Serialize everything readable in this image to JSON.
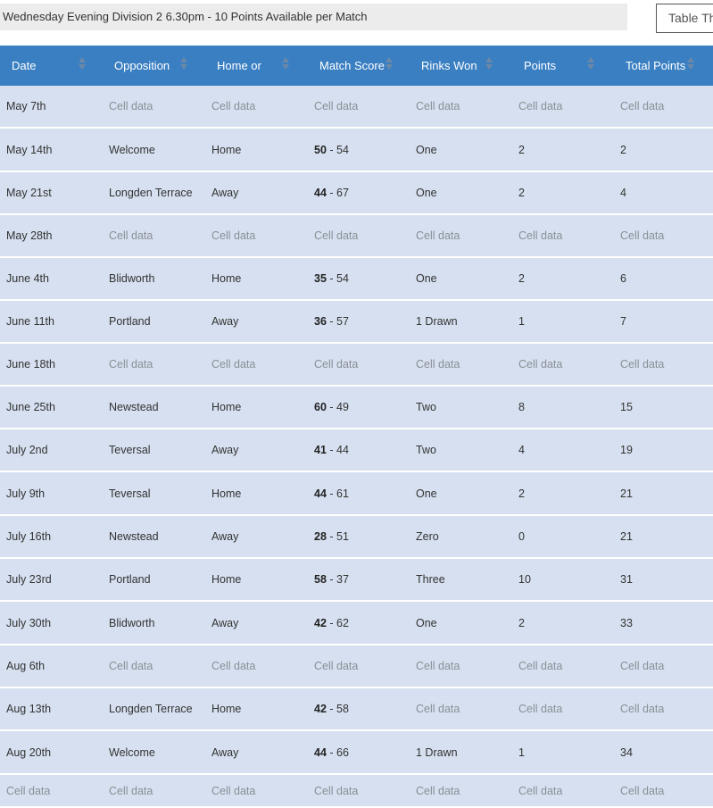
{
  "header": {
    "title": "Wednesday Evening Division 2 6.30pm - 10 Points Available per Match",
    "table_button": "Table Th"
  },
  "columns": [
    "Date",
    "Opposition",
    "Home or",
    "Match Score",
    "Rinks Won",
    "Points",
    "Total Points"
  ],
  "rows": [
    {
      "date": "May 7th",
      "opposition": "Cell data",
      "home_away": "Cell data",
      "score": "Cell data",
      "rinks": "Cell data",
      "points": "Cell data",
      "total": "Cell data"
    },
    {
      "date": "May 14th",
      "opposition": "Welcome",
      "home_away": "Home",
      "score_home": "50",
      "score_away": "- 54",
      "rinks": "One",
      "points": "2",
      "total": "2"
    },
    {
      "date": "May 21st",
      "opposition": "Longden Terrace",
      "home_away": "Away",
      "score_home": "44",
      "score_away": "- 67",
      "rinks": "One",
      "points": "2",
      "total": "4"
    },
    {
      "date": "May 28th",
      "opposition": "Cell data",
      "home_away": "Cell data",
      "score": "Cell data",
      "rinks": "Cell data",
      "points": "Cell data",
      "total": "Cell data"
    },
    {
      "date": "June 4th",
      "opposition": "Blidworth",
      "home_away": "Home",
      "score_home": "35",
      "score_away": "- 54",
      "rinks": "One",
      "points": "2",
      "total": "6"
    },
    {
      "date": "June 11th",
      "opposition": "Portland",
      "home_away": "Away",
      "score_home": "36",
      "score_away": "- 57",
      "rinks": "1 Drawn",
      "points": "1",
      "total": "7"
    },
    {
      "date": "June 18th",
      "opposition": "Cell data",
      "home_away": "Cell data",
      "score": "Cell data",
      "rinks": "Cell data",
      "points": "Cell data",
      "total": "Cell data"
    },
    {
      "date": "June 25th",
      "opposition": "Newstead",
      "home_away": "Home",
      "score_home": "60",
      "score_away": "- 49",
      "rinks": "Two",
      "points": "8",
      "total": "15"
    },
    {
      "date": "July 2nd",
      "opposition": "Teversal",
      "home_away": "Away",
      "score_home": "41",
      "score_away": "- 44",
      "rinks": "Two",
      "points": "4",
      "total": "19"
    },
    {
      "date": "July 9th",
      "opposition": "Teversal",
      "home_away": "Home",
      "score_home": "44",
      "score_away": "- 61",
      "rinks": "One",
      "points": "2",
      "total": "21"
    },
    {
      "date": "July 16th",
      "opposition": "Newstead",
      "home_away": "Away",
      "score_home": "28",
      "score_away": "- 51",
      "rinks": "Zero",
      "points": "0",
      "total": "21"
    },
    {
      "date": "July 23rd",
      "opposition": "Portland",
      "home_away": "Home",
      "score_home": "58",
      "score_away": "- 37",
      "rinks": "Three",
      "points": "10",
      "total": "31"
    },
    {
      "date": "July 30th",
      "opposition": "Blidworth",
      "home_away": "Away",
      "score_home": "42",
      "score_away": "- 62",
      "rinks": "One",
      "points": "2",
      "total": "33"
    },
    {
      "date": "Aug 6th",
      "opposition": "Cell data",
      "home_away": "Cell data",
      "score": "Cell data",
      "rinks": "Cell data",
      "points": "Cell data",
      "total": "Cell data"
    },
    {
      "date": "Aug 13th",
      "opposition": "Longden Terrace",
      "home_away": "Home",
      "score_home": "42",
      "score_away": "- 58",
      "rinks": "Cell data",
      "points": "Cell data",
      "total": "Cell data"
    },
    {
      "date": "Aug 20th",
      "opposition": "Welcome",
      "home_away": "Away",
      "score_home": "44",
      "score_away": "- 66",
      "rinks": "1 Drawn",
      "points": "1",
      "total": "34"
    },
    {
      "date": "Cell data",
      "opposition": "Cell data",
      "home_away": "Cell data",
      "score": "Cell data",
      "rinks": "Cell data",
      "points": "Cell data",
      "total": "Cell data"
    }
  ],
  "colors": {
    "header_bg": "#3a7fc2",
    "row_bg": "#d6e0f0",
    "placeholder_text": "#8a8f96"
  },
  "icons": {
    "sort": "sort-arrows-icon",
    "partial_glyph": "˙"
  }
}
